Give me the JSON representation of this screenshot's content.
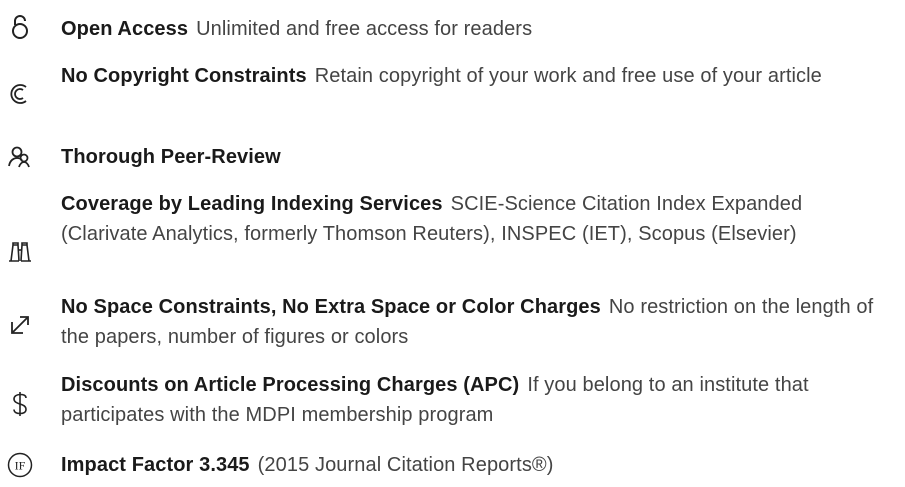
{
  "features": [
    {
      "icon": "open-lock-icon",
      "title": "Open Access",
      "description": "Unlimited and free access for readers"
    },
    {
      "icon": "copyright-icon",
      "title": "No Copyright Constraints",
      "description": "Retain copyright of your work and free use of your article"
    },
    {
      "icon": "peer-review-icon",
      "title": "Thorough Peer-Review",
      "description": ""
    },
    {
      "icon": "binoculars-icon",
      "title": "Coverage by Leading Indexing Services",
      "description": "SCIE-Science Citation Index Expanded (Clarivate Analytics, formerly Thomson Reuters), INSPEC (IET), Scopus (Elsevier)"
    },
    {
      "icon": "expand-arrow-icon",
      "title": "No Space Constraints, No Extra Space or Color Charges",
      "description": "No restriction on the length of the papers, number of figures or colors"
    },
    {
      "icon": "dollar-icon",
      "title": "Discounts on Article Processing Charges (APC)",
      "description": "If you belong to an institute that participates with the MDPI membership program"
    },
    {
      "icon": "impact-factor-icon",
      "title": "Impact Factor 3.345",
      "description": "(2015 Journal Citation Reports®)"
    }
  ]
}
